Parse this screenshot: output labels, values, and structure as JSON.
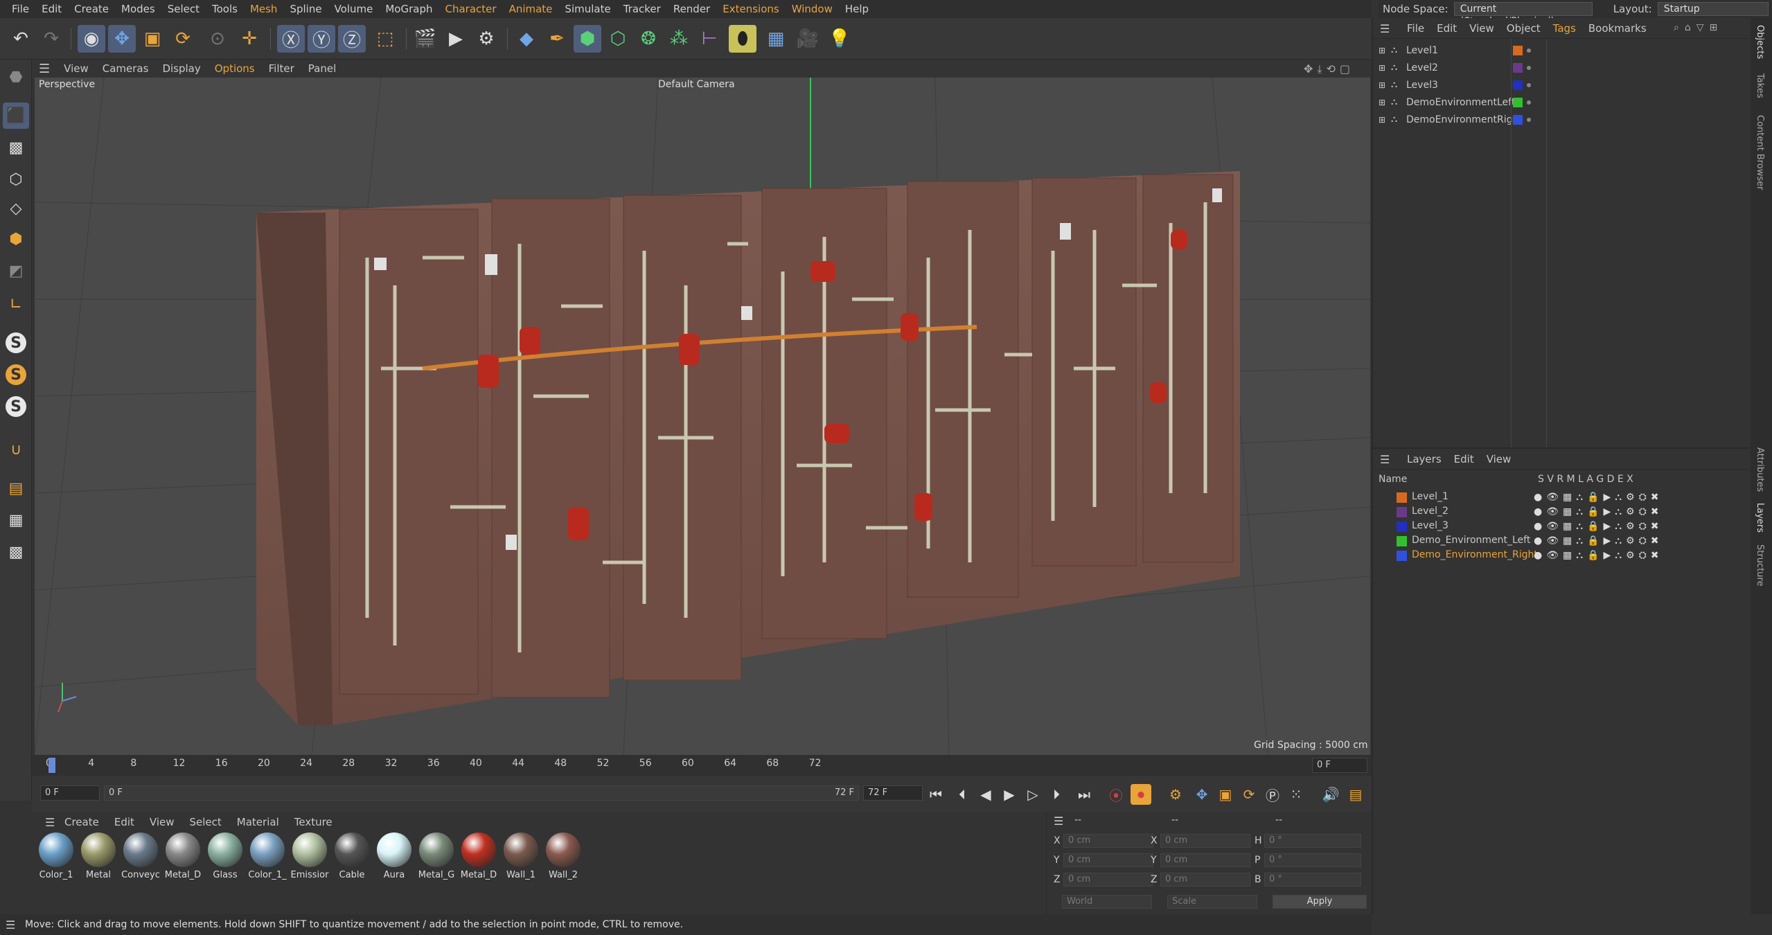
{
  "menu": [
    "File",
    "Edit",
    "Create",
    "Modes",
    "Select",
    "Tools",
    "Mesh",
    "Spline",
    "Volume",
    "MoGraph",
    "Character",
    "Animate",
    "Simulate",
    "Tracker",
    "Render",
    "Extensions",
    "Window",
    "Help"
  ],
  "menu_highlight": [
    "Mesh",
    "Character",
    "Animate",
    "Extensions",
    "Window"
  ],
  "nodespace": {
    "label": "Node Space:",
    "value": "Current (Standard/Physical)",
    "layout_label": "Layout:",
    "layout_value": "Startup"
  },
  "toolbar_icons": [
    "undo-icon",
    "redo-icon",
    "select-icon",
    "move-icon",
    "scale-icon",
    "rotate-icon",
    "recent-icon",
    "move-tool-icon",
    "x-axis-icon",
    "y-axis-icon",
    "z-axis-icon",
    "coord-system-icon",
    "render-region-icon",
    "render-view-icon",
    "render-settings-icon",
    "cube-icon",
    "pen-icon",
    "subdivision-icon",
    "extrude-icon",
    "mograph-cloner-icon",
    "cubes-icon",
    "deformer-icon",
    "field-icon",
    "floor-icon",
    "camera-icon",
    "light-icon"
  ],
  "viewport": {
    "menu": [
      "View",
      "Cameras",
      "Display",
      "Options",
      "Filter",
      "Panel"
    ],
    "label": "Perspective",
    "camera": "Default Camera",
    "grid_spacing": "Grid Spacing : 5000 cm"
  },
  "timeline": {
    "ticks": [
      "0",
      "4",
      "8",
      "12",
      "16",
      "20",
      "24",
      "28",
      "32",
      "36",
      "40",
      "44",
      "48",
      "52",
      "56",
      "60",
      "64",
      "68",
      "72"
    ],
    "current": "0 F",
    "start": "0 F",
    "range_start": "0 F",
    "range_end": "72 F",
    "end": "72 F"
  },
  "materials": {
    "menu": [
      "Create",
      "Edit",
      "View",
      "Select",
      "Material",
      "Texture"
    ],
    "items": [
      {
        "name": "Color_1",
        "color": "#6aa0c8"
      },
      {
        "name": "Metal",
        "color": "#9a9a6a"
      },
      {
        "name": "Conveyc",
        "color": "#6a7a8a"
      },
      {
        "name": "Metal_D",
        "color": "#888888"
      },
      {
        "name": "Glass",
        "color": "#8ab0a0"
      },
      {
        "name": "Color_1_",
        "color": "#7aa0c0"
      },
      {
        "name": "Emissior",
        "color": "#b0c0a0"
      },
      {
        "name": "Cable",
        "color": "#555555"
      },
      {
        "name": "Aura",
        "color": "#d8f4f8"
      },
      {
        "name": "Metal_G",
        "color": "#7a8a7a"
      },
      {
        "name": "Metal_D",
        "color": "#c03020"
      },
      {
        "name": "Wall_1",
        "color": "#7a5a4e"
      },
      {
        "name": "Wall_2",
        "color": "#8a5a50"
      }
    ]
  },
  "coords": {
    "rows": [
      {
        "a": "X",
        "av": "0 cm",
        "b": "X",
        "bv": "0 cm",
        "c": "H",
        "cv": "0 °"
      },
      {
        "a": "Y",
        "av": "0 cm",
        "b": "Y",
        "bv": "0 cm",
        "c": "P",
        "cv": "0 °"
      },
      {
        "a": "Z",
        "av": "0 cm",
        "b": "Z",
        "bv": "0 cm",
        "c": "B",
        "cv": "0 °"
      }
    ],
    "world": "World",
    "scale": "Scale",
    "apply": "Apply",
    "dash1": "--",
    "dash2": "--",
    "dash3": "--"
  },
  "status": "Move: Click and drag to move elements. Hold down SHIFT to quantize movement / add to the selection in point mode, CTRL to remove.",
  "objects": {
    "menu": [
      "File",
      "Edit",
      "View",
      "Object",
      "Tags",
      "Bookmarks"
    ],
    "items": [
      {
        "name": "Level1",
        "color": "#d86a20"
      },
      {
        "name": "Level2",
        "color": "#6a3a8a"
      },
      {
        "name": "Level3",
        "color": "#2030c0"
      },
      {
        "name": "DemoEnvironmentLeft",
        "color": "#30c030"
      },
      {
        "name": "DemoEnvironmentRight",
        "color": "#3050e0"
      }
    ]
  },
  "layers": {
    "menu": [
      "Layers",
      "Edit",
      "View"
    ],
    "header": {
      "name": "Name",
      "cols": "S  V  R  M  L   A  G  D  E  X"
    },
    "items": [
      {
        "name": "Level_1",
        "color": "#d86a20",
        "active": false
      },
      {
        "name": "Level_2",
        "color": "#6a3a8a",
        "active": false
      },
      {
        "name": "Level_3",
        "color": "#2030c0",
        "active": false
      },
      {
        "name": "Demo_Environment_Left",
        "color": "#30c030",
        "active": false
      },
      {
        "name": "Demo_Environment_Right",
        "color": "#3050e0",
        "active": true
      }
    ]
  },
  "side_tabs": [
    "Objects",
    "Takes",
    "Content Browser",
    "Attributes",
    "Layers",
    "Structure"
  ],
  "colors": {
    "accent": "#e9a43a",
    "bg": "#333333"
  }
}
